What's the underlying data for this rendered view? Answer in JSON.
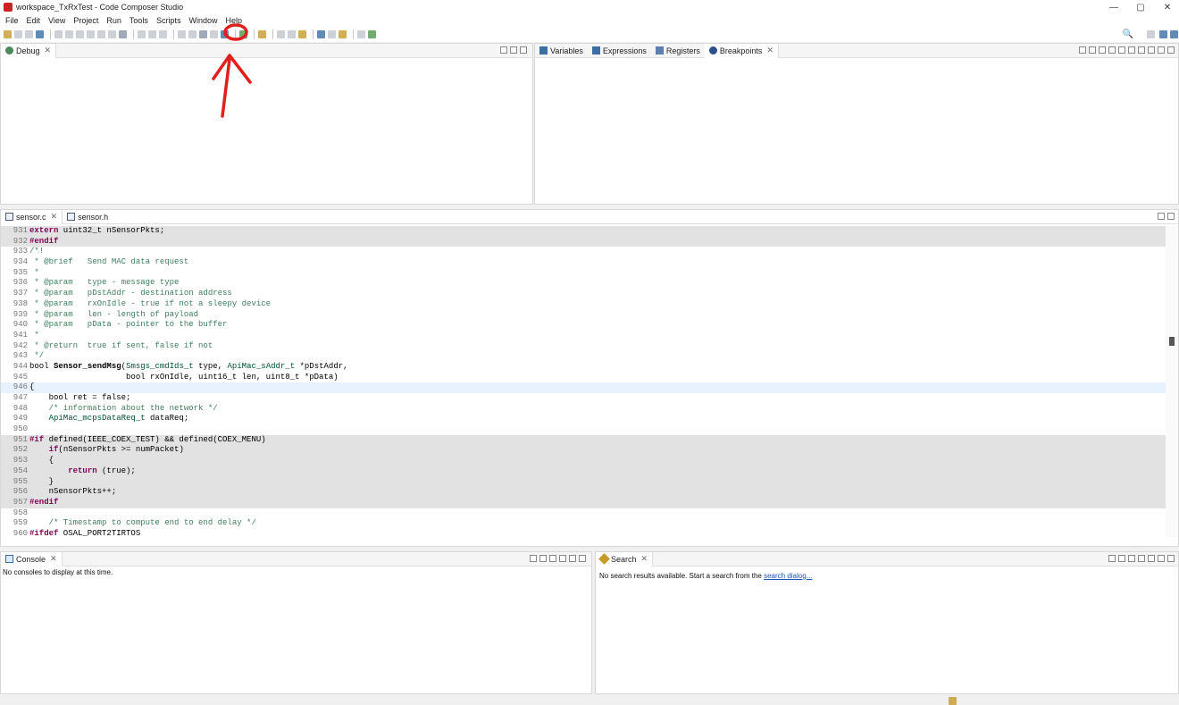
{
  "window": {
    "title": "workspace_TxRxTest - Code Composer Studio",
    "minimize": "—",
    "maximize": "▢",
    "close": "✕"
  },
  "menu": [
    "File",
    "Edit",
    "View",
    "Project",
    "Run",
    "Tools",
    "Scripts",
    "Window",
    "Help"
  ],
  "debug_pane": {
    "tab": "Debug"
  },
  "variables_pane": {
    "tabs": [
      "Variables",
      "Expressions",
      "Registers",
      "Breakpoints"
    ]
  },
  "editor": {
    "tabs": [
      "sensor.c",
      "sensor.h"
    ],
    "lines": [
      {
        "n": "931",
        "bg": "gray",
        "parts": [
          [
            "kw",
            "extern"
          ],
          [
            "code",
            " uint32_t nSensorPkts;"
          ]
        ]
      },
      {
        "n": "932",
        "bg": "gray",
        "parts": [
          [
            "dir",
            "#endif"
          ]
        ]
      },
      {
        "n": "933",
        "bg": "",
        "parts": [
          [
            "cm",
            "/*!"
          ]
        ]
      },
      {
        "n": "934",
        "bg": "",
        "parts": [
          [
            "cm",
            " * @brief   Send MAC data request"
          ]
        ]
      },
      {
        "n": "935",
        "bg": "",
        "parts": [
          [
            "cm",
            " *"
          ]
        ]
      },
      {
        "n": "936",
        "bg": "",
        "parts": [
          [
            "cm",
            " * @param   type - message type"
          ]
        ]
      },
      {
        "n": "937",
        "bg": "",
        "parts": [
          [
            "cm",
            " * @param   pDstAddr - destination address"
          ]
        ]
      },
      {
        "n": "938",
        "bg": "",
        "parts": [
          [
            "cm",
            " * @param   rxOnIdle - true if not a sleepy device"
          ]
        ]
      },
      {
        "n": "939",
        "bg": "",
        "parts": [
          [
            "cm",
            " * @param   len - length of payload"
          ]
        ]
      },
      {
        "n": "940",
        "bg": "",
        "parts": [
          [
            "cm",
            " * @param   pData - pointer to the buffer"
          ]
        ]
      },
      {
        "n": "941",
        "bg": "",
        "parts": [
          [
            "cm",
            " *"
          ]
        ]
      },
      {
        "n": "942",
        "bg": "",
        "parts": [
          [
            "cm",
            " * @return  true if sent, false if not"
          ]
        ]
      },
      {
        "n": "943",
        "bg": "",
        "parts": [
          [
            "cm",
            " */"
          ]
        ]
      },
      {
        "n": "944",
        "bg": "",
        "parts": [
          [
            "code",
            "bool "
          ],
          [
            "fn",
            "Sensor_sendMsg"
          ],
          [
            "code",
            "("
          ],
          [
            "ty",
            "Smsgs_cmdIds_t"
          ],
          [
            "code",
            " type, "
          ],
          [
            "ty",
            "ApiMac_sAddr_t"
          ],
          [
            "code",
            " *pDstAddr,"
          ]
        ]
      },
      {
        "n": "945",
        "bg": "",
        "parts": [
          [
            "code",
            "                    bool rxOnIdle, uint16_t len, uint8_t *pData)"
          ]
        ]
      },
      {
        "n": "946",
        "bg": "cur",
        "parts": [
          [
            "code",
            "{"
          ]
        ]
      },
      {
        "n": "947",
        "bg": "",
        "parts": [
          [
            "code",
            "    bool ret = false;"
          ]
        ]
      },
      {
        "n": "948",
        "bg": "",
        "parts": [
          [
            "cm",
            "    /* information about the network */"
          ]
        ]
      },
      {
        "n": "949",
        "bg": "",
        "parts": [
          [
            "ty",
            "    ApiMac_mcpsDataReq_t"
          ],
          [
            "code",
            " dataReq;"
          ]
        ]
      },
      {
        "n": "950",
        "bg": "",
        "parts": [
          [
            "code",
            ""
          ]
        ]
      },
      {
        "n": "951",
        "bg": "gray",
        "parts": [
          [
            "dir",
            "#if"
          ],
          [
            "code",
            " defined(IEEE_COEX_TEST) && defined(COEX_MENU)"
          ]
        ]
      },
      {
        "n": "952",
        "bg": "gray",
        "parts": [
          [
            "code",
            "    "
          ],
          [
            "kw",
            "if"
          ],
          [
            "code",
            "(nSensorPkts >= numPacket)"
          ]
        ]
      },
      {
        "n": "953",
        "bg": "gray",
        "parts": [
          [
            "code",
            "    {"
          ]
        ]
      },
      {
        "n": "954",
        "bg": "gray",
        "parts": [
          [
            "code",
            "        "
          ],
          [
            "kw",
            "return"
          ],
          [
            "code",
            " (true);"
          ]
        ]
      },
      {
        "n": "955",
        "bg": "gray",
        "parts": [
          [
            "code",
            "    }"
          ]
        ]
      },
      {
        "n": "956",
        "bg": "gray",
        "parts": [
          [
            "code",
            "    nSensorPkts++;"
          ]
        ]
      },
      {
        "n": "957",
        "bg": "gray",
        "parts": [
          [
            "dir",
            "#endif"
          ]
        ]
      },
      {
        "n": "958",
        "bg": "",
        "parts": [
          [
            "code",
            ""
          ]
        ]
      },
      {
        "n": "959",
        "bg": "",
        "parts": [
          [
            "cm",
            "    /* Timestamp to compute end to end delay */"
          ]
        ]
      },
      {
        "n": "960",
        "bg": "",
        "parts": [
          [
            "dir",
            "#ifdef"
          ],
          [
            "code",
            " OSAL_PORT2TIRTOS"
          ]
        ]
      }
    ]
  },
  "console": {
    "tab": "Console",
    "message": "No consoles to display at this time."
  },
  "search": {
    "tab": "Search",
    "message": "No search results available. Start a search from the ",
    "link": "search dialog",
    "suffix": "..."
  },
  "colors": {
    "annotation": "#e0201c",
    "current_line": "#e8f2fe",
    "inactive_code": "#e2e2e2"
  }
}
